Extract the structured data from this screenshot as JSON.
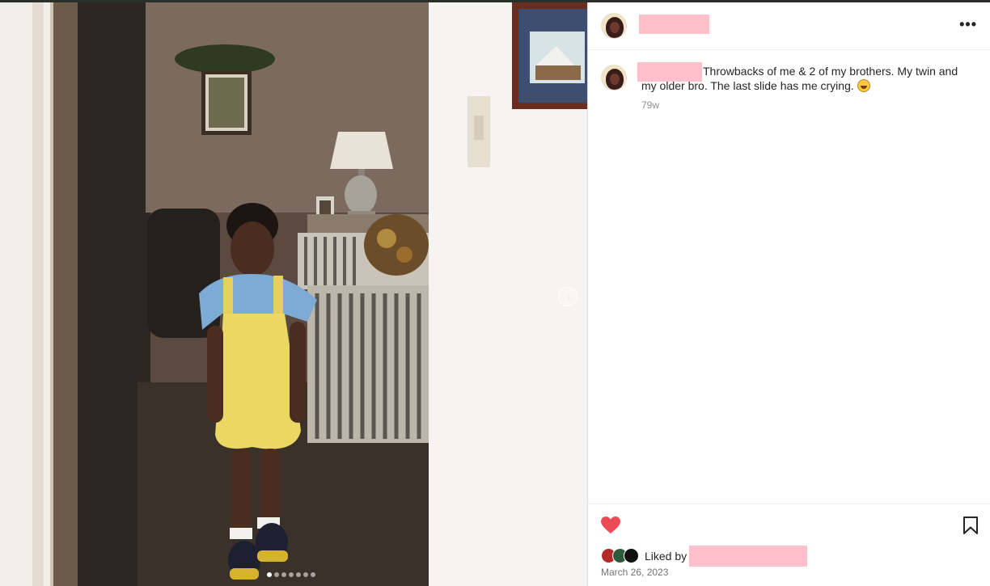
{
  "post": {
    "username": "",
    "caption": "Throwbacks of me & 2 of my brothers. My twin and my older bro. The last slide has me crying.",
    "caption_emoji": "grinning-squinting-face",
    "age": "79w",
    "date": "March 26, 2023"
  },
  "likes": {
    "prefix": "Liked by",
    "liker_username": ""
  },
  "carousel": {
    "slide_count": 7,
    "active_slide": 1
  },
  "colors": {
    "heart": "#ed4956",
    "redaction": "#ffc0cb",
    "muted_text": "#8e8e8e"
  }
}
